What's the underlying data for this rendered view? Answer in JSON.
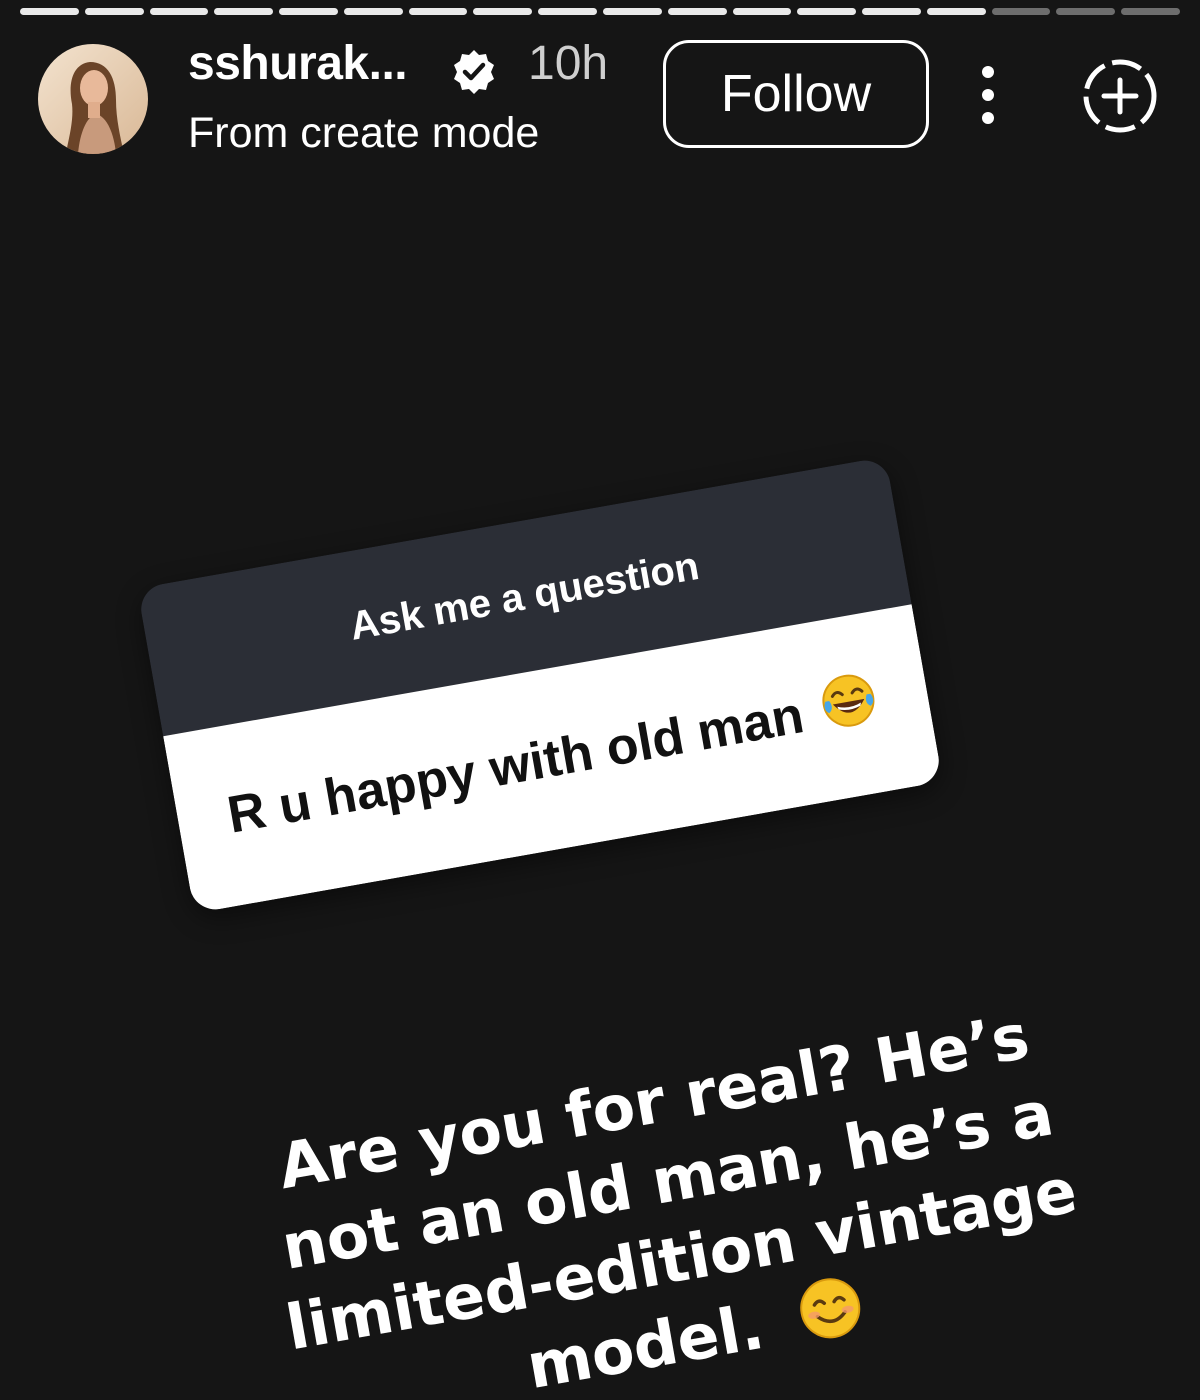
{
  "story": {
    "progress": {
      "segments_total": 18,
      "segments_viewed": 15
    },
    "header": {
      "username": "sshurak...",
      "verified": true,
      "time_ago": "10h",
      "subtitle": "From create mode",
      "follow_label": "Follow",
      "icons": {
        "verified": "verified-badge-icon",
        "more": "more-vertical-icon",
        "add_story": "add-story-icon"
      }
    },
    "question_sticker": {
      "prompt": "Ask me a question",
      "question": "R u happy with old man",
      "question_emoji": "😂"
    },
    "reply": {
      "lines": [
        "Are you for real? He’s",
        "not an old man, he’s a",
        "limited-edition vintage",
        "model."
      ],
      "emoji": "😊"
    }
  },
  "colors": {
    "background": "#151515",
    "sticker_header": "#2b2e36",
    "sticker_body": "#ffffff",
    "text": "#ffffff"
  }
}
